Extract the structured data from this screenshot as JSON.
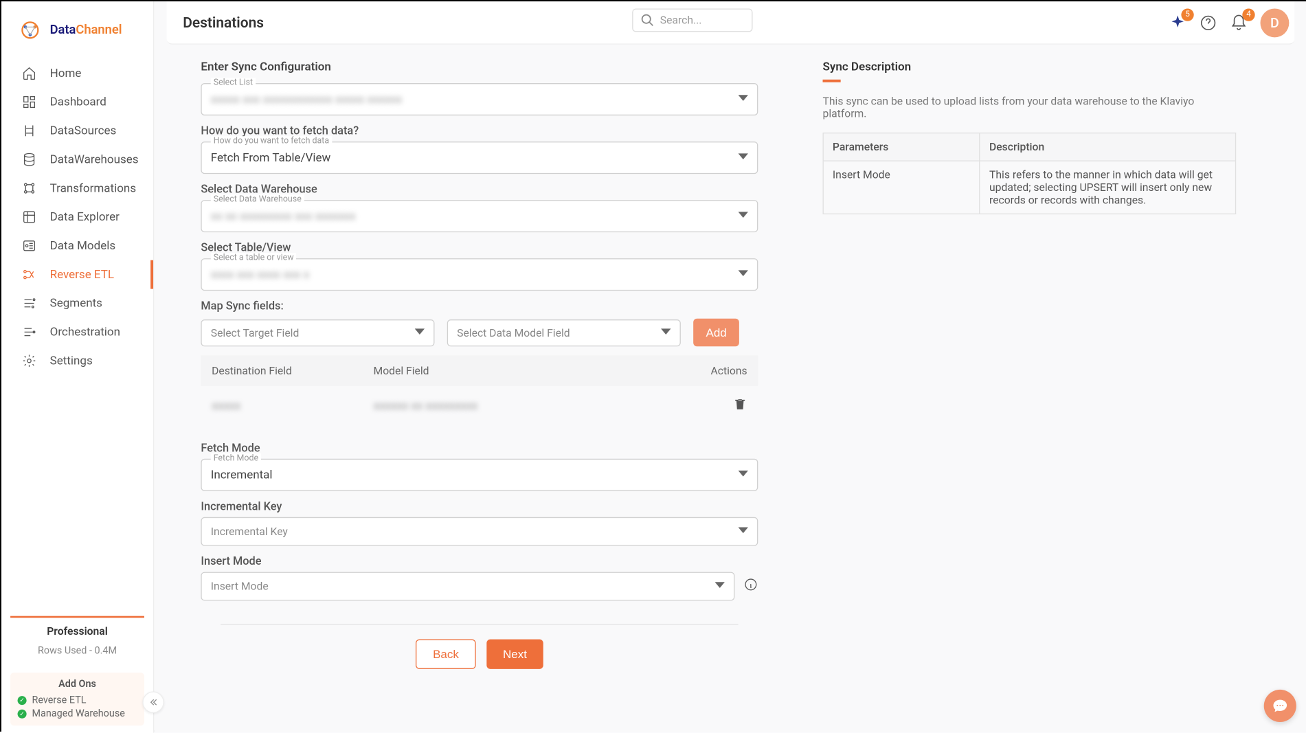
{
  "brand": {
    "data": "Data",
    "channel": "Channel"
  },
  "nav": {
    "items": [
      {
        "label": "Home"
      },
      {
        "label": "Dashboard"
      },
      {
        "label": "DataSources"
      },
      {
        "label": "DataWarehouses"
      },
      {
        "label": "Transformations"
      },
      {
        "label": "Data Explorer"
      },
      {
        "label": "Data Models"
      },
      {
        "label": "Reverse ETL"
      },
      {
        "label": "Segments"
      },
      {
        "label": "Orchestration"
      },
      {
        "label": "Settings"
      }
    ]
  },
  "plan": {
    "name": "Professional",
    "rows_used": "Rows Used - 0.4M"
  },
  "addons": {
    "title": "Add Ons",
    "items": [
      {
        "label": "Reverse ETL"
      },
      {
        "label": "Managed Warehouse"
      }
    ]
  },
  "topbar": {
    "page_title": "Destinations",
    "search_placeholder": "Search...",
    "spark_badge": "5",
    "bell_badge": "4",
    "avatar_initial": "D"
  },
  "form": {
    "section_title": "Enter Sync Configuration",
    "select_list_label": "Select List",
    "select_list_value": "xxxxx xxx xxxxxxxxxxxx xxxxx  xxxxxx",
    "fetch_question": "How do you want to fetch data?",
    "fetch_floating": "How do you want to fetch data",
    "fetch_value": "Fetch From Table/View",
    "select_dw_heading": "Select Data Warehouse",
    "select_dw_floating": "Select Data Warehouse",
    "select_dw_value": "xx xx xxxxxxxxx xxx xxxxxxx",
    "select_table_heading": "Select Table/View",
    "select_table_floating": "Select a table or view",
    "select_table_value": "xxxx xxx xxxx xxx x",
    "map_sync_heading": "Map Sync fields:",
    "target_placeholder": "Select Target Field",
    "model_placeholder": "Select Data Model Field",
    "add_label": "Add",
    "map_headers": {
      "c1": "Destination Field",
      "c2": "Model Field",
      "c3": "Actions"
    },
    "map_row": {
      "c1": "xxxxx",
      "c2": "xxxxxx xx xxxxxxxxx"
    },
    "fetch_mode_heading": "Fetch Mode",
    "fetch_mode_floating": "Fetch Mode",
    "fetch_mode_value": "Incremental",
    "inc_key_heading": "Incremental Key",
    "inc_key_placeholder": "Incremental Key",
    "insert_mode_heading": "Insert Mode",
    "insert_mode_placeholder": "Insert Mode",
    "back_label": "Back",
    "next_label": "Next"
  },
  "description": {
    "title": "Sync Description",
    "text": "This sync can be used to upload lists from your data warehouse to the Klaviyo platform.",
    "th1": "Parameters",
    "th2": "Description",
    "row": {
      "param": "Insert Mode",
      "desc": "This refers to the manner in which data will get updated; selecting UPSERT will insert only new records or records with changes."
    }
  }
}
